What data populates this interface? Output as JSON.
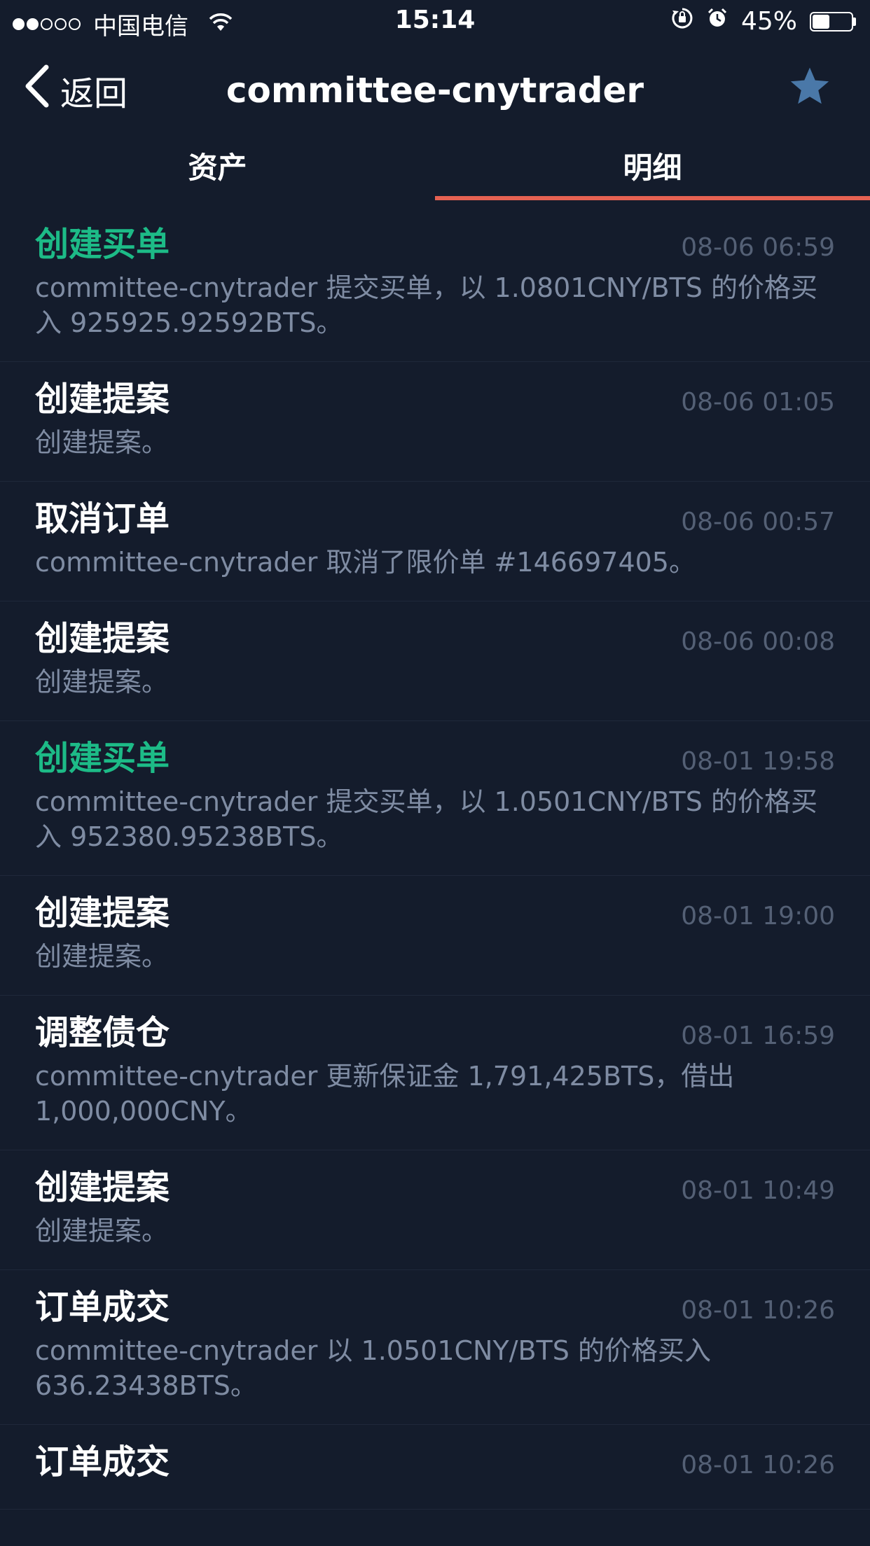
{
  "status": {
    "carrier": "中国电信",
    "time": "15:14",
    "battery": "45%",
    "battery_level": 0.45,
    "signal_bars": 2
  },
  "nav": {
    "back_label": "返回",
    "title": "committee-cnytrader"
  },
  "tabs": [
    {
      "label": "资产",
      "active": false
    },
    {
      "label": "明细",
      "active": true
    }
  ],
  "colors": {
    "background": "#141c2c",
    "accent_buy": "#1dbb87",
    "tab_underline": "#e66152",
    "star": "#4a78a8"
  },
  "items": [
    {
      "title": "创建买单",
      "type": "buy",
      "time": "08-06 06:59",
      "desc": "committee-cnytrader 提交买单，以 1.0801CNY/BTS 的价格买入 925925.92592BTS。"
    },
    {
      "title": "创建提案",
      "type": "normal",
      "time": "08-06 01:05",
      "desc": "创建提案。"
    },
    {
      "title": "取消订单",
      "type": "normal",
      "time": "08-06 00:57",
      "desc": "committee-cnytrader 取消了限价单 #146697405。"
    },
    {
      "title": "创建提案",
      "type": "normal",
      "time": "08-06 00:08",
      "desc": "创建提案。"
    },
    {
      "title": "创建买单",
      "type": "buy",
      "time": "08-01 19:58",
      "desc": "committee-cnytrader 提交买单，以 1.0501CNY/BTS 的价格买入 952380.95238BTS。"
    },
    {
      "title": "创建提案",
      "type": "normal",
      "time": "08-01 19:00",
      "desc": "创建提案。"
    },
    {
      "title": "调整债仓",
      "type": "normal",
      "time": "08-01 16:59",
      "desc": "committee-cnytrader 更新保证金 1,791,425BTS，借出 1,000,000CNY。"
    },
    {
      "title": "创建提案",
      "type": "normal",
      "time": "08-01 10:49",
      "desc": "创建提案。"
    },
    {
      "title": "订单成交",
      "type": "normal",
      "time": "08-01 10:26",
      "desc": "committee-cnytrader 以 1.0501CNY/BTS 的价格买入 636.23438BTS。"
    },
    {
      "title": "订单成交",
      "type": "normal",
      "time": "08-01 10:26",
      "desc": ""
    }
  ]
}
